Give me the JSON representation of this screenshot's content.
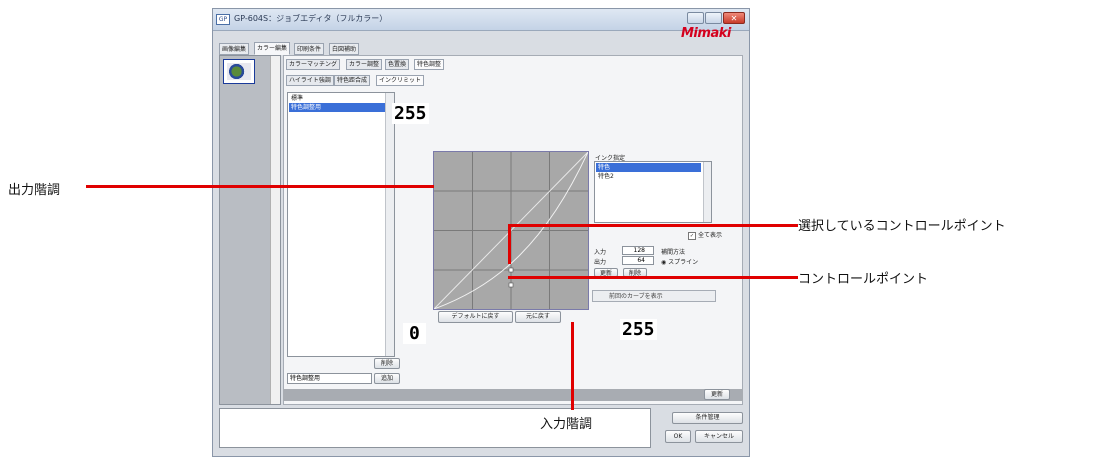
{
  "window": {
    "title": "GP-604S：ジョブエディタ（フルカラー）",
    "logo": "Mimaki",
    "title_icon": "GP",
    "close_glyph": "✕"
  },
  "top_tabs": [
    "画像編集",
    "カラー編集",
    "印刷条件",
    "白図補助"
  ],
  "sub_tabs": [
    "カラーマッチング",
    "カラー調整",
    "色置換",
    "特色調整"
  ],
  "sub_sub_tabs": [
    "ハイライト強調",
    "特色距合成",
    "インクリミット"
  ],
  "list": {
    "items": [
      "標準",
      "特色調整用"
    ],
    "selected_index": 1,
    "delete_label": "削除",
    "name_value": "特色調整用",
    "add_label": "追加"
  },
  "graph": {
    "default_button": "デフォルトに戻す",
    "undo_button": "元に戻す"
  },
  "ink_panel": {
    "label": "インク指定",
    "items": [
      "特色",
      "特色2"
    ],
    "selected_index": 0,
    "show_all_label": "全て表示",
    "input_label": "入力",
    "input_value": "128",
    "output_label": "出力",
    "output_value": "64",
    "interp_label": "補間方法",
    "interp_option": "スプライン",
    "btn_a": "更新",
    "btn_b": "削除",
    "prev_curve_label": "前回のカーブを表示"
  },
  "update_button": "更新",
  "bottom": {
    "cond_button": "条件管理",
    "ok_button": "OK",
    "cancel_button": "キャンセル"
  },
  "annotations": {
    "output_gradation": "出力階調",
    "selected_control_point": "選択しているコントロールポイント",
    "control_point": "コントロールポイント",
    "input_gradation": "入力階調",
    "y_max": "255",
    "origin": "0",
    "x_max": "255"
  },
  "colors": {
    "annotation_line": "#e00000",
    "selection": "#3a6fd8",
    "brand": "#d4001d"
  },
  "icons": [
    "window-app-icon",
    "minimize-icon",
    "maximize-icon",
    "close-icon",
    "thumbnail-image",
    "checkbox-icon",
    "radio-icon",
    "spinner-icon"
  ]
}
